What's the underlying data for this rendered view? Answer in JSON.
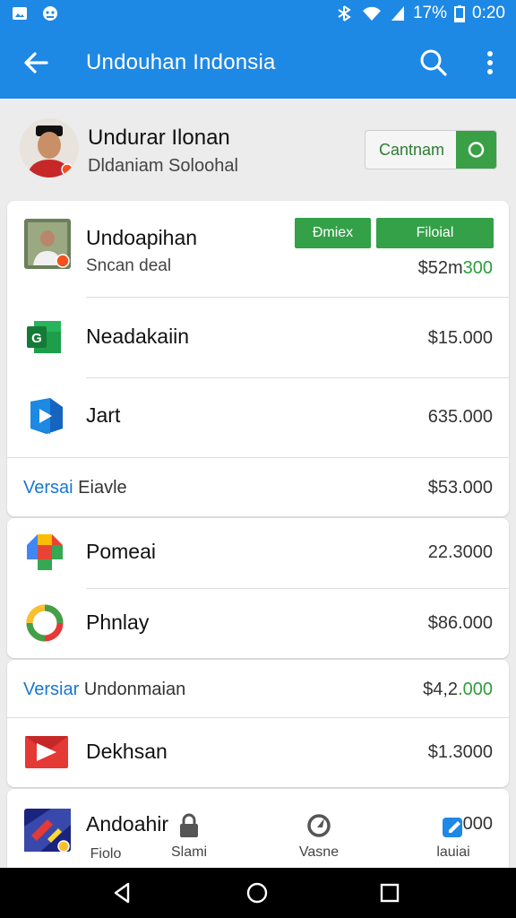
{
  "status_bar": {
    "battery": "17%",
    "time": "0:20"
  },
  "app_bar": {
    "title": "Undouhan Indonsia"
  },
  "profile": {
    "name": "Undurar Ilonan",
    "subtitle": "Dldaniam Soloohal",
    "connect_label": "Cantnam"
  },
  "featured": {
    "title": "Undoapihan",
    "subtitle": "Sncan deal",
    "button1": "Ðmiex",
    "button2": "Filoial",
    "price_prefix": "$52m",
    "price_suffix": "300"
  },
  "items_group1": [
    {
      "title": "Neadakaiin",
      "price": "$15.000",
      "icon": "sheets-icon"
    },
    {
      "title": "Jart",
      "price": "635.000",
      "icon": "play-arrow-icon"
    }
  ],
  "section1": {
    "accent": "Versai",
    "label": "Eiavle",
    "price": "$53.000"
  },
  "items_group2": [
    {
      "title": "Pomeai",
      "price": "22.3000",
      "icon": "plus-colored-icon"
    },
    {
      "title": "Phnlay",
      "price": "$86.000",
      "icon": "ring-icon"
    }
  ],
  "section2": {
    "accent": "Versiar",
    "label": "Undonmaian",
    "price_prefix": "$4,2",
    "price_suffix": ".000"
  },
  "items_group3": [
    {
      "title": "Dekhsan",
      "price": "$1.3000",
      "icon": "youtube-play-icon"
    }
  ],
  "last_item": {
    "title": "Andoahir",
    "price": "000"
  },
  "bottom_nav": [
    {
      "label": "Fiolo",
      "icon": "none"
    },
    {
      "label": "Slami",
      "icon": "lock-icon"
    },
    {
      "label": "Vasne",
      "icon": "compass-icon"
    },
    {
      "label": "lauiai",
      "icon": "edit-icon"
    }
  ],
  "colors": {
    "primary": "#1e88e5",
    "green": "#34a048",
    "accent_blue": "#1976d2"
  }
}
